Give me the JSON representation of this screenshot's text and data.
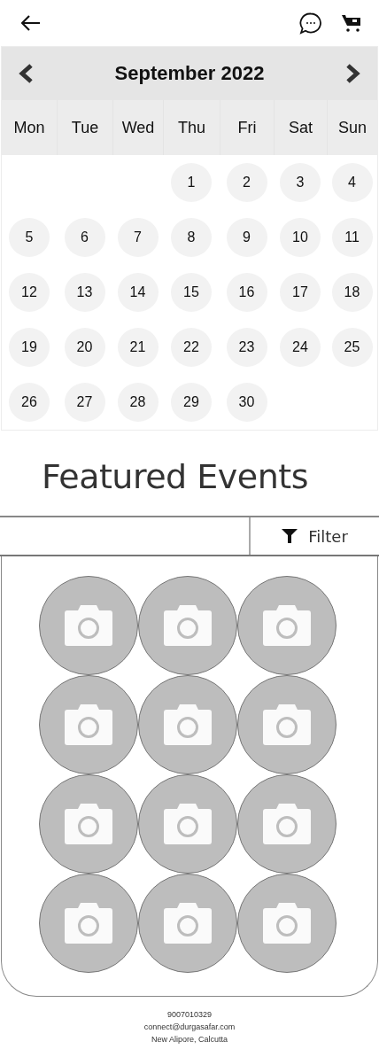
{
  "calendar": {
    "title": "September 2022",
    "weekdays": [
      "Mon",
      "Tue",
      "Wed",
      "Thu",
      "Fri",
      "Sat",
      "Sun"
    ],
    "weeks": [
      [
        {
          "kind": "blank"
        },
        {
          "kind": "blank"
        },
        {
          "kind": "blank"
        },
        {
          "kind": "day",
          "label": "1"
        },
        {
          "kind": "day",
          "label": "2"
        },
        {
          "kind": "day",
          "label": "3"
        },
        {
          "kind": "day",
          "label": "4"
        }
      ],
      [
        {
          "kind": "day",
          "label": "5"
        },
        {
          "kind": "day",
          "label": "6"
        },
        {
          "kind": "day",
          "label": "7"
        },
        {
          "kind": "day",
          "label": "8"
        },
        {
          "kind": "day",
          "label": "9"
        },
        {
          "kind": "day",
          "label": "10"
        },
        {
          "kind": "day",
          "label": "11"
        }
      ],
      [
        {
          "kind": "day",
          "label": "12"
        },
        {
          "kind": "day",
          "label": "13"
        },
        {
          "kind": "day",
          "label": "14"
        },
        {
          "kind": "day",
          "label": "15"
        },
        {
          "kind": "day",
          "label": "16"
        },
        {
          "kind": "day",
          "label": "17"
        },
        {
          "kind": "day",
          "label": "18"
        }
      ],
      [
        {
          "kind": "day",
          "label": "19"
        },
        {
          "kind": "day",
          "label": "20"
        },
        {
          "kind": "day",
          "label": "21"
        },
        {
          "kind": "day",
          "label": "22"
        },
        {
          "kind": "day",
          "label": "23"
        },
        {
          "kind": "day",
          "label": "24"
        },
        {
          "kind": "day",
          "label": "25"
        }
      ],
      [
        {
          "kind": "day",
          "label": "26"
        },
        {
          "kind": "day",
          "label": "27"
        },
        {
          "kind": "day",
          "label": "28"
        },
        {
          "kind": "day",
          "label": "29"
        },
        {
          "kind": "day",
          "label": "30"
        },
        {
          "kind": "blank"
        },
        {
          "kind": "blank"
        }
      ]
    ]
  },
  "section_title": "Featured Events",
  "filter": {
    "label": "Filter"
  },
  "events": [
    {
      "kind": "placeholder"
    },
    {
      "kind": "placeholder"
    },
    {
      "kind": "placeholder"
    },
    {
      "kind": "placeholder"
    },
    {
      "kind": "placeholder"
    },
    {
      "kind": "placeholder"
    },
    {
      "kind": "placeholder"
    },
    {
      "kind": "placeholder"
    },
    {
      "kind": "placeholder"
    },
    {
      "kind": "placeholder"
    },
    {
      "kind": "placeholder"
    },
    {
      "kind": "placeholder"
    }
  ],
  "footer": [
    "9007010329",
    "connect@durgasafar.com",
    "New Alipore, Calcutta"
  ]
}
